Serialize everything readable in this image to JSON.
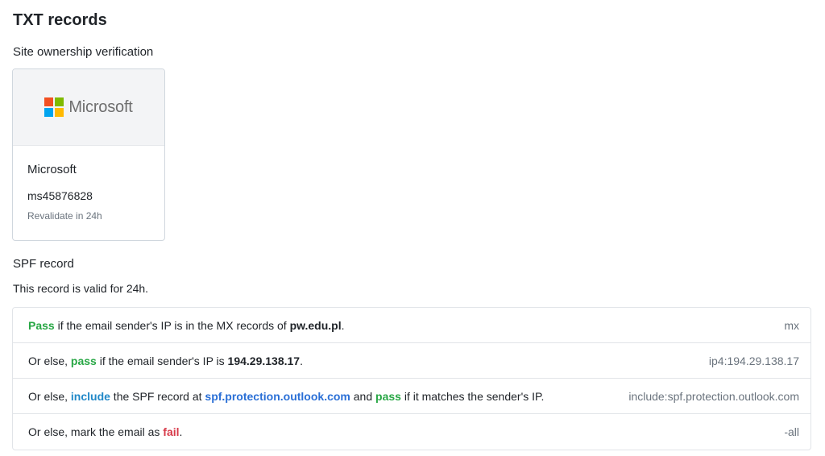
{
  "page": {
    "title": "TXT records"
  },
  "ownership": {
    "title": "Site ownership verification",
    "card": {
      "logo_icon": "microsoft-logo",
      "logo_wordmark": "Microsoft",
      "logo_colors": [
        "#f25022",
        "#7fba00",
        "#00a4ef",
        "#ffb900"
      ],
      "provider": "Microsoft",
      "code": "ms45876828",
      "revalidate": "Revalidate in 24h"
    }
  },
  "spf": {
    "title": "SPF record",
    "validity": "This record is valid for 24h.",
    "colors": {
      "pass": "#28a745",
      "fail": "#d73a49",
      "include": "#2188c8"
    },
    "rows": [
      {
        "parts": [
          {
            "text": "Pass",
            "style": "pass"
          },
          {
            "text": " if the email sender's IP is in the MX records of ",
            "style": "plain"
          },
          {
            "text": "pw.edu.pl",
            "style": "bold"
          },
          {
            "text": ".",
            "style": "plain"
          }
        ],
        "mechanism": "mx"
      },
      {
        "parts": [
          {
            "text": "Or else, ",
            "style": "plain"
          },
          {
            "text": "pass",
            "style": "pass"
          },
          {
            "text": " if the email sender's IP is ",
            "style": "plain"
          },
          {
            "text": "194.29.138.17",
            "style": "bold"
          },
          {
            "text": ".",
            "style": "plain"
          }
        ],
        "mechanism": "ip4:194.29.138.17"
      },
      {
        "parts": [
          {
            "text": "Or else, ",
            "style": "plain"
          },
          {
            "text": "include",
            "style": "include"
          },
          {
            "text": " the SPF record at ",
            "style": "plain"
          },
          {
            "text": "spf.protection.outlook.com",
            "style": "host"
          },
          {
            "text": " and ",
            "style": "plain"
          },
          {
            "text": "pass",
            "style": "pass"
          },
          {
            "text": " if it matches the sender's IP.",
            "style": "plain"
          }
        ],
        "mechanism": "include:spf.protection.outlook.com"
      },
      {
        "parts": [
          {
            "text": "Or else, mark the email as ",
            "style": "plain"
          },
          {
            "text": "fail",
            "style": "fail"
          },
          {
            "text": ".",
            "style": "plain"
          }
        ],
        "mechanism": "-all"
      }
    ]
  }
}
